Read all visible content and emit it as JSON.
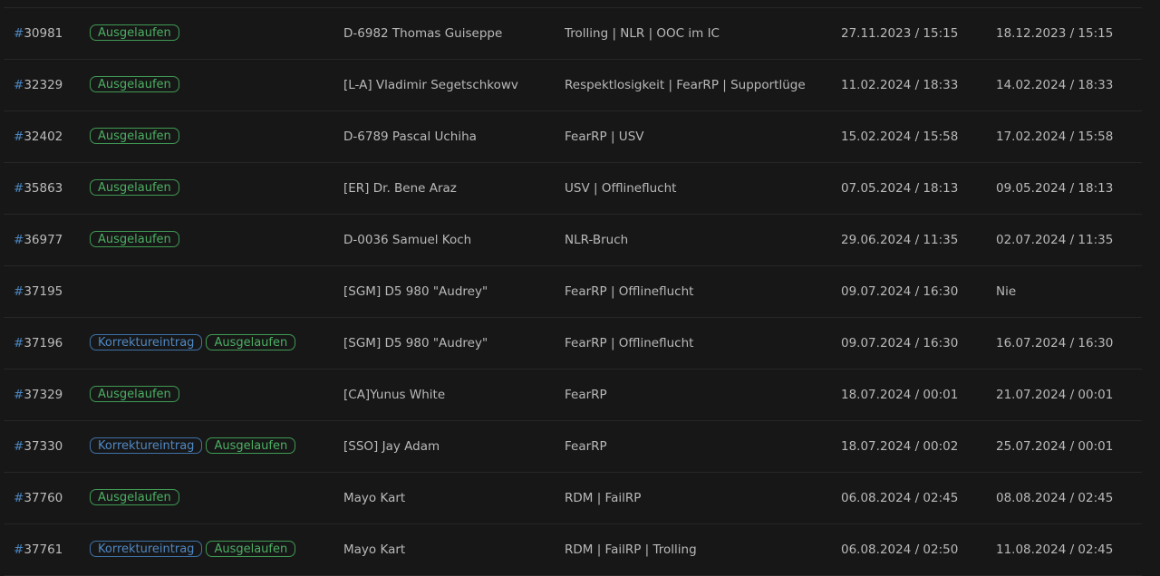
{
  "labels": {
    "expired": "Ausgelaufen",
    "correction": "Korrektureintrag",
    "hash": "#"
  },
  "colors": {
    "background": "#171717",
    "text": "#b9b9b9",
    "id_hash": "#4a86c0",
    "badge_expired": "#4caf63",
    "badge_correction": "#4f88c4",
    "divider": "#262626"
  },
  "rows": [
    {
      "id": "30981",
      "correction": false,
      "expired": true,
      "name": "D-6982 Thomas Guiseppe",
      "reason": "Trolling | NLR | OOC im IC",
      "start": "27.11.2023 / 15:15",
      "end": "18.12.2023 / 15:15"
    },
    {
      "id": "32329",
      "correction": false,
      "expired": true,
      "name": "[L-A] Vladimir Segetschkowv",
      "reason": "Respektlosigkeit | FearRP | Supportlüge",
      "start": "11.02.2024 / 18:33",
      "end": "14.02.2024 / 18:33"
    },
    {
      "id": "32402",
      "correction": false,
      "expired": true,
      "name": "D-6789 Pascal Uchiha",
      "reason": "FearRP | USV",
      "start": "15.02.2024 / 15:58",
      "end": "17.02.2024 / 15:58"
    },
    {
      "id": "35863",
      "correction": false,
      "expired": true,
      "name": "[ER] Dr. Bene Araz",
      "reason": "USV | Offlineflucht",
      "start": "07.05.2024 / 18:13",
      "end": "09.05.2024 / 18:13"
    },
    {
      "id": "36977",
      "correction": false,
      "expired": true,
      "name": "D-0036 Samuel Koch",
      "reason": "NLR-Bruch",
      "start": "29.06.2024 / 11:35",
      "end": "02.07.2024 / 11:35"
    },
    {
      "id": "37195",
      "correction": false,
      "expired": false,
      "name": "[SGM] D5 980 \"Audrey\"",
      "reason": "FearRP | Offlineflucht",
      "start": "09.07.2024 / 16:30",
      "end": "Nie"
    },
    {
      "id": "37196",
      "correction": true,
      "expired": true,
      "name": "[SGM] D5 980 \"Audrey\"",
      "reason": "FearRP | Offlineflucht",
      "start": "09.07.2024 / 16:30",
      "end": "16.07.2024 / 16:30"
    },
    {
      "id": "37329",
      "correction": false,
      "expired": true,
      "name": "[CA]Yunus White",
      "reason": "FearRP",
      "start": "18.07.2024 / 00:01",
      "end": "21.07.2024 / 00:01"
    },
    {
      "id": "37330",
      "correction": true,
      "expired": true,
      "name": "[SSO] Jay Adam",
      "reason": "FearRP",
      "start": "18.07.2024 / 00:02",
      "end": "25.07.2024 / 00:01"
    },
    {
      "id": "37760",
      "correction": false,
      "expired": true,
      "name": "Mayo Kart",
      "reason": "RDM | FailRP",
      "start": "06.08.2024 / 02:45",
      "end": "08.08.2024 / 02:45"
    },
    {
      "id": "37761",
      "correction": true,
      "expired": true,
      "name": "Mayo Kart",
      "reason": "RDM | FailRP | Trolling",
      "start": "06.08.2024 / 02:50",
      "end": "11.08.2024 / 02:45"
    }
  ]
}
